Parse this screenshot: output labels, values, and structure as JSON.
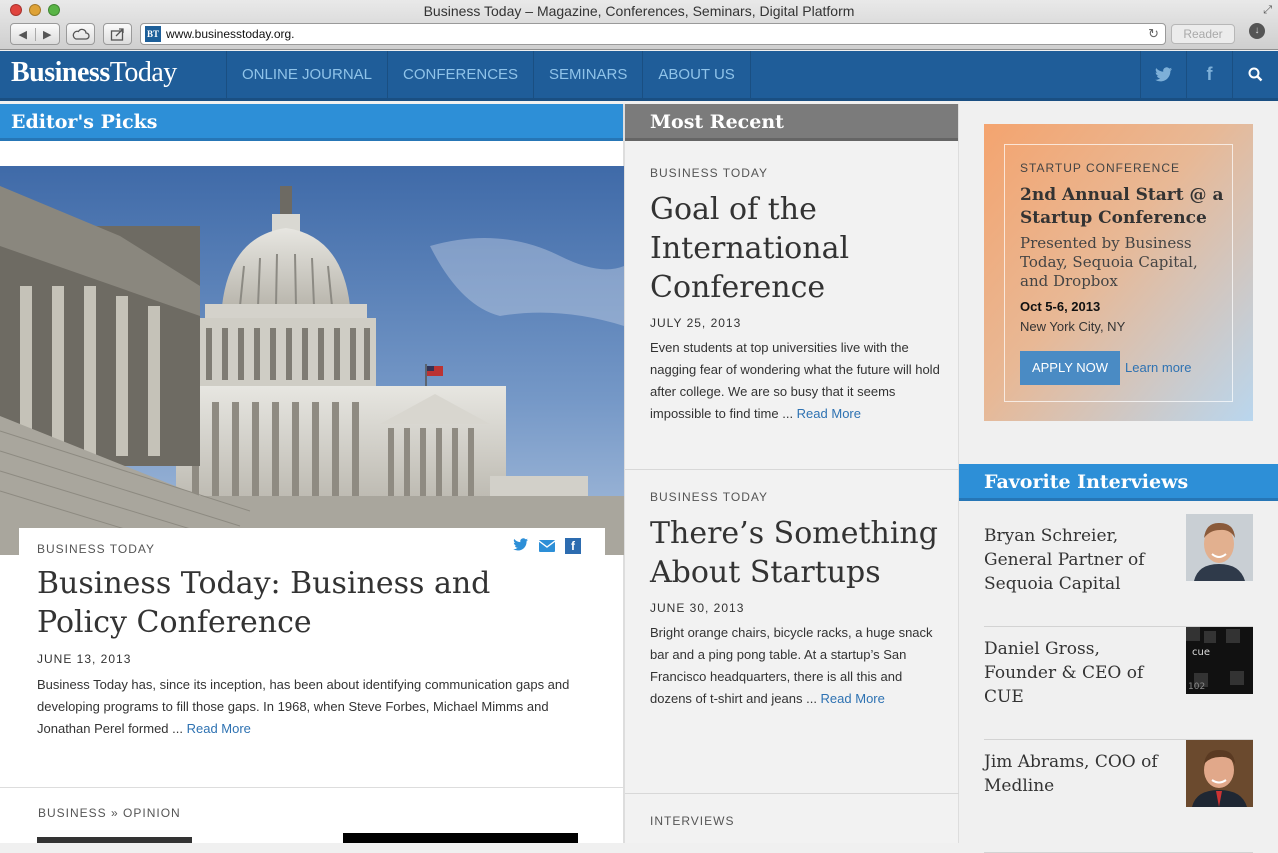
{
  "browser": {
    "window_title": "Business Today – Magazine, Conferences, Seminars, Digital Platform",
    "url": "www.businesstoday.org.",
    "favicon_text": "BT",
    "reader_label": "Reader"
  },
  "site": {
    "logo_business": "Business",
    "logo_today": "Today",
    "nav": [
      "ONLINE JOURNAL",
      "CONFERENCES",
      "SEMINARS",
      "ABOUT US"
    ],
    "header_icons": [
      "twitter-icon",
      "facebook-icon",
      "search-icon"
    ]
  },
  "editors_picks": {
    "heading": "Editor's Picks",
    "feature": {
      "eyebrow": "BUSINESS TODAY",
      "title": "Business Today: Business and Policy Conference",
      "date": "JUNE 13, 2013",
      "excerpt": "Business Today has, since its inception, has been about identifying communication gaps and developing programs to fill those gaps. In 1968, when Steve Forbes, Michael Mimms and Jonathan Perel formed ... ",
      "read_more": "Read More"
    },
    "next_eyebrow": "BUSINESS » OPINION"
  },
  "most_recent": {
    "heading": "Most Recent",
    "posts": [
      {
        "eyebrow": "BUSINESS TODAY",
        "title": "Goal of the International Conference",
        "date": "JULY 25, 2013",
        "excerpt": "Even students at top universities live with the nagging fear of wondering what the future will hold after college. We are so busy that it seems impossible to find time ... ",
        "read_more": "Read More"
      },
      {
        "eyebrow": "BUSINESS TODAY",
        "title": "There’s Something About Startups",
        "date": "JUNE 30, 2013",
        "excerpt": "Bright orange chairs, bicycle racks, a huge snack bar and a ping pong table. At a startup’s San Francisco headquarters, there is all this and dozens of t-shirt and jeans ... ",
        "read_more": "Read More"
      }
    ],
    "next_eyebrow": "INTERVIEWS"
  },
  "promo": {
    "eyebrow": "STARTUP CONFERENCE",
    "title": "2nd Annual Start @ a Startup Conference",
    "subtitle": "Presented by Business Today, Sequoia Capital, and Dropbox",
    "date": "Oct 5-6, 2013",
    "location": "New York City, NY",
    "apply_label": "APPLY NOW",
    "learn_label": "Learn more"
  },
  "favorite_interviews": {
    "heading": "Favorite Interviews",
    "items": [
      {
        "name": "Bryan Schreier, General Partner of Sequoia Capital"
      },
      {
        "name": "Daniel Gross, Founder & CEO of CUE"
      },
      {
        "name": "Jim Abrams, COO of Medline"
      }
    ]
  },
  "colors": {
    "brand_blue": "#1f5d99",
    "section_blue": "#2d8fd7",
    "link_blue": "#2e72b2",
    "recent_gray": "#7b7b7b"
  }
}
